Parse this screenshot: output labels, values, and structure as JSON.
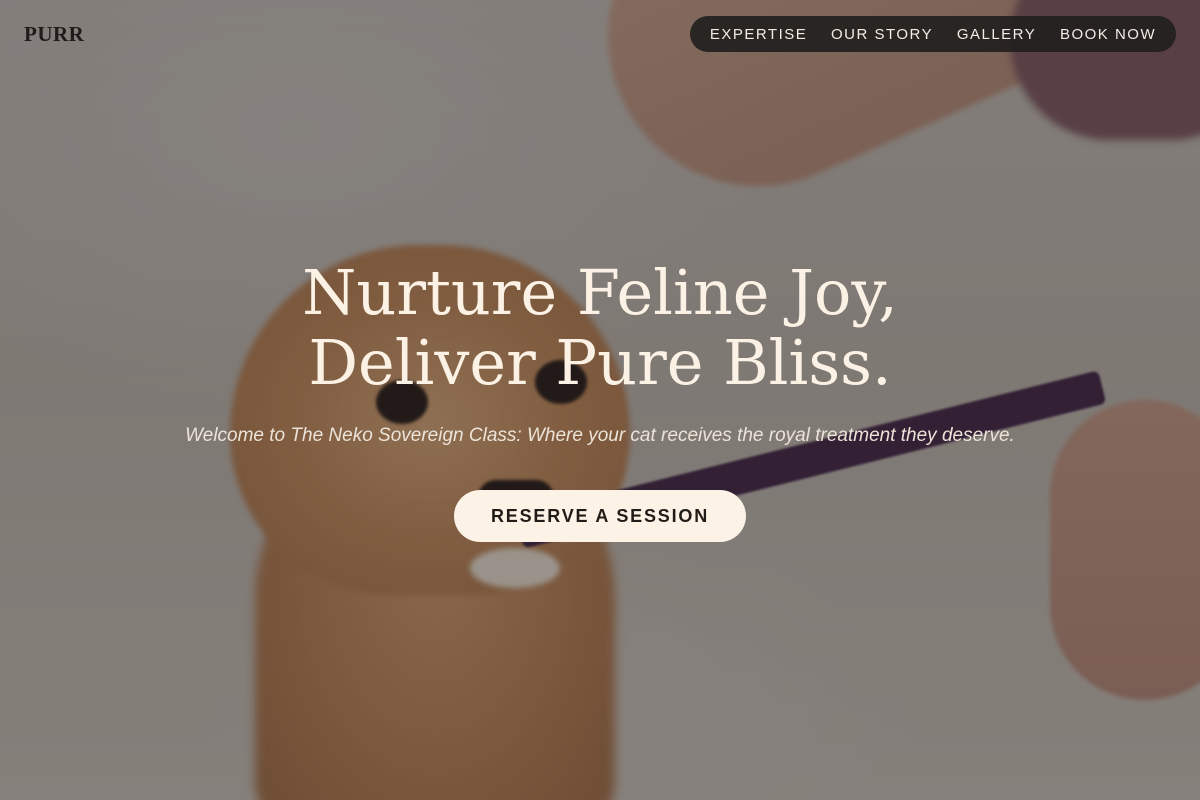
{
  "header": {
    "logo": "PURR",
    "nav": [
      {
        "label": "EXPERTISE"
      },
      {
        "label": "OUR STORY"
      },
      {
        "label": "GALLERY"
      },
      {
        "label": "BOOK NOW"
      }
    ]
  },
  "hero": {
    "title_line1": "Nurture Feline Joy,",
    "title_line2": "Deliver Pure Bliss.",
    "subtitle": "Welcome to The Neko Sovereign Class: Where your cat receives the royal treatment they deserve.",
    "cta_label": "RESERVE A SESSION"
  },
  "colors": {
    "title": "#fbf1e4",
    "cta_background": "#fcf2e6",
    "nav_background": "#22201e"
  }
}
